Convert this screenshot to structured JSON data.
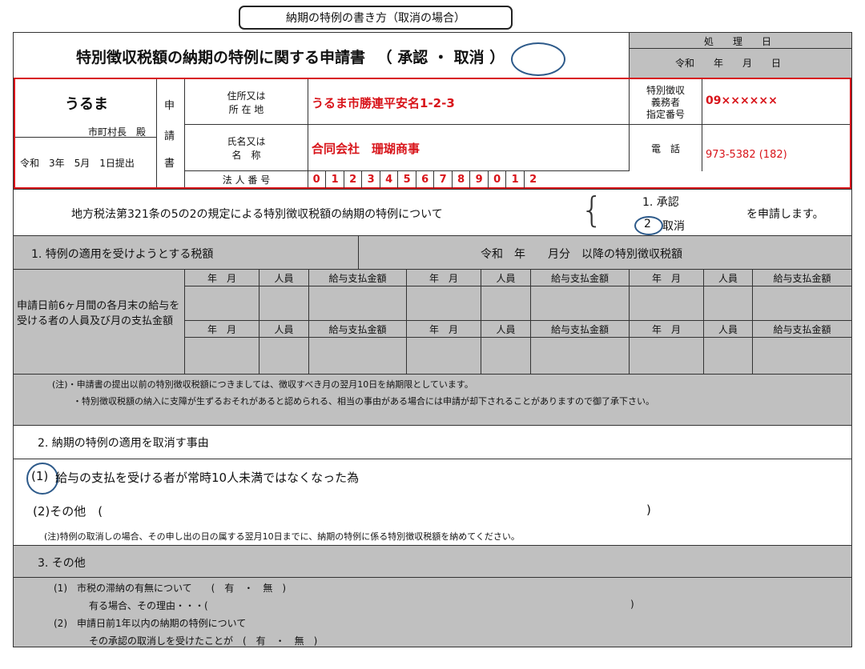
{
  "caption": "納期の特例の書き方（取消の場合）",
  "header": {
    "title": "特別徴収税額の納期の特例に関する申請書",
    "title_paren_open": "（",
    "title_approve": "承認",
    "title_dot": "・",
    "title_cancel": "取消",
    "title_paren_close": "）",
    "processing_date": "処　　理　　日",
    "reiwa_date": "令和　　年　　月　　日"
  },
  "applicant": {
    "city": "うるま",
    "mayor": "市町村長　殿",
    "submit_date": "令和　3年　5月　1日提出",
    "form_label": [
      "申",
      "請",
      "書"
    ],
    "address_label": "住所又は\n所 在 地",
    "address_value": "うるま市勝連平安名1-2-3",
    "name_label": "氏名又は\n名　称",
    "name_value": "合同会社　珊瑚商事",
    "corp_no_label": "法 人 番 号",
    "corp_no_digits": [
      "0",
      "1",
      "2",
      "3",
      "4",
      "5",
      "6",
      "7",
      "8",
      "9",
      "0",
      "1",
      "2"
    ],
    "designation_label": "特別徴収\n義務者\n指定番号",
    "designation_value": "09××××××",
    "phone_label": "電　話",
    "phone_value": "973-5382 (182)"
  },
  "statement": {
    "text": "地方税法第321条の5の2の規定による特別徴収税額の納期の特例について",
    "opt1": "1. 承認",
    "opt2_num": "2",
    "opt2_text": "取消",
    "suffix": "を申請します。"
  },
  "section1": {
    "heading": "1. 特例の適用を受けようとする税額",
    "right_heading": "令和　年　　月分　以降の特別徴収税額",
    "row_label": "申請日前6ヶ月間の各月末の給与を受ける者の人員及び月の支払金額",
    "col_headers": [
      "年　月",
      "人員",
      "給与支払金額",
      "年　月",
      "人員",
      "給与支払金額",
      "年　月",
      "人員",
      "給与支払金額"
    ],
    "note1": "(注)・申請書の提出以前の特別徴収税額につきましては、徴収すべき月の翌月10日を納期限としています。",
    "note2": "・特別徴収税額の納入に支障が生ずるおそれがあると認められる、相当の事由がある場合には申請が却下されることがありますので御了承下さい。"
  },
  "section2": {
    "heading": "2. 納期の特例の適用を取消す事由",
    "item1_num": "(1)",
    "item1_text": "給与の支払を受ける者が常時10人未満ではなくなった為",
    "item2": "(2)その他　(",
    "item2_close": ")",
    "note": "(注)特例の取消しの場合、その申し出の日の属する翌月10日までに、納期の特例に係る特別徴収税額を納めてください。"
  },
  "section3": {
    "heading": "3. その他",
    "line1": "(1)　市税の滞納の有無について　　(　有　・　無　)",
    "line2": "有る場合、その理由・・・(",
    "line2_close": ")",
    "line3": "(2)　申請日前1年以内の納期の特例について",
    "line4": "その承認の取消しを受けたことが　(　有　・　無　)"
  }
}
